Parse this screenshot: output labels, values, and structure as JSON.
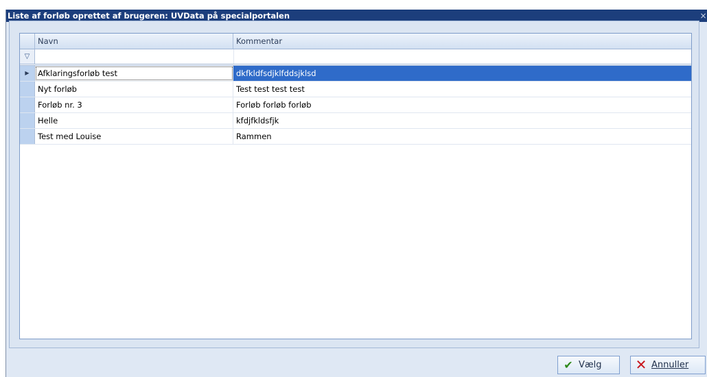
{
  "window": {
    "title": "Liste af forløb oprettet af brugeren: UVData på specialportalen",
    "close_glyph": "×"
  },
  "grid": {
    "columns": [
      "Navn",
      "Kommentar"
    ],
    "filter_icon": "funnel-icon",
    "rows": [
      {
        "navn": "Afklaringsforløb test",
        "kommentar": "dkfkldfsdjklfddsjklsd",
        "selected": true
      },
      {
        "navn": "Nyt forløb",
        "kommentar": "Test test test test"
      },
      {
        "navn": "Forløb nr. 3",
        "kommentar": "Forløb forløb forløb"
      },
      {
        "navn": "Helle",
        "kommentar": "kfdjfkldsfjk"
      },
      {
        "navn": "Test med Louise",
        "kommentar": "Rammen"
      }
    ]
  },
  "buttons": {
    "ok_label": "Vælg",
    "ok_icon": "checkmark-icon",
    "cancel_label": "Annuller",
    "cancel_icon": "x-icon"
  },
  "colors": {
    "titlebar": "#1c3e7c",
    "selection": "#2f6bc9",
    "indicator": "#bcd2ef"
  }
}
